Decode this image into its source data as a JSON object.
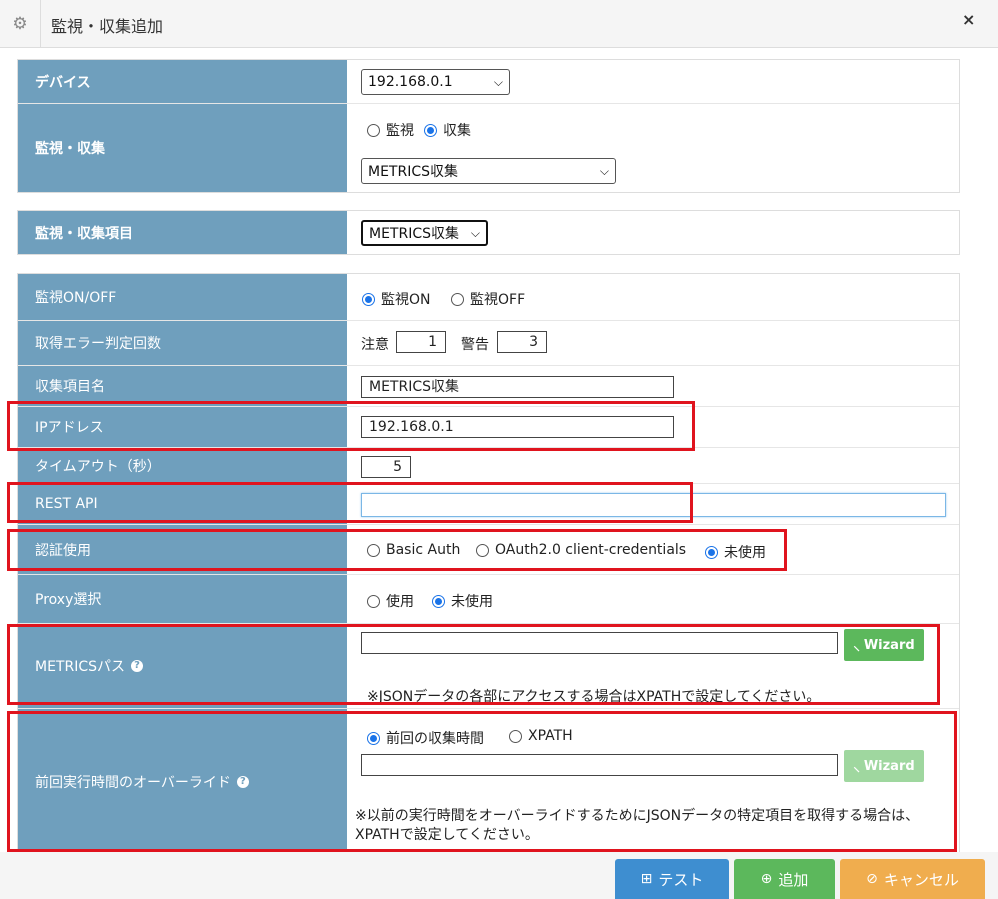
{
  "window": {
    "title": "監視・収集追加",
    "close": "×"
  },
  "section1": {
    "device_label": "デバイス",
    "device_value": "192.168.0.1",
    "monitor_label": "監視・収集",
    "radio_monitor": "監視",
    "radio_collect": "収集",
    "type_value": "METRICS収集"
  },
  "section2": {
    "item_label": "監視・収集項目",
    "item_value": "METRICS収集"
  },
  "section3": {
    "onoff_label": "監視ON/OFF",
    "radio_on": "監視ON",
    "radio_off": "監視OFF",
    "error_label": "取得エラー判定回数",
    "caution_label": "注意",
    "caution_value": "1",
    "warning_label": "警告",
    "warning_value": "3",
    "name_label": "収集項目名",
    "name_value": "METRICS収集",
    "ip_label": "IPアドレス",
    "ip_value": "192.168.0.1",
    "timeout_label": "タイムアウト（秒）",
    "timeout_value": "5",
    "rest_label": "REST API",
    "rest_value": "",
    "auth_label": "認証使用",
    "auth_basic": "Basic Auth",
    "auth_oauth": "OAuth2.0 client-credentials",
    "auth_none": "未使用",
    "proxy_label": "Proxy選択",
    "proxy_use": "使用",
    "proxy_none": "未使用",
    "metrics_label": "METRICSパス",
    "metrics_value": "",
    "wizard": "Wizard",
    "metrics_note": "※JSONデータの各部にアクセスする場合はXPATHで設定してください。",
    "override_label": "前回実行時間のオーバーライド",
    "override_prev": "前回の収集時間",
    "override_xpath": "XPATH",
    "override_value": "",
    "override_note": "※以前の実行時間をオーバーライドするためにJSONデータの特定項目を取得する場合は、XPATHで設定してください。"
  },
  "footer": {
    "test": "テスト",
    "add": "追加",
    "cancel": "キャンセル"
  },
  "colors": {
    "label_bg": "#6f9fbd",
    "highlight": "#e0141e",
    "test": "#3e8ed0",
    "add": "#5cb85c",
    "cancel": "#f0ad4e"
  },
  "icons": [
    "gear-icon",
    "close-icon",
    "question-icon",
    "wand-icon",
    "sitemap-icon",
    "plus-circle-icon",
    "ban-icon"
  ]
}
